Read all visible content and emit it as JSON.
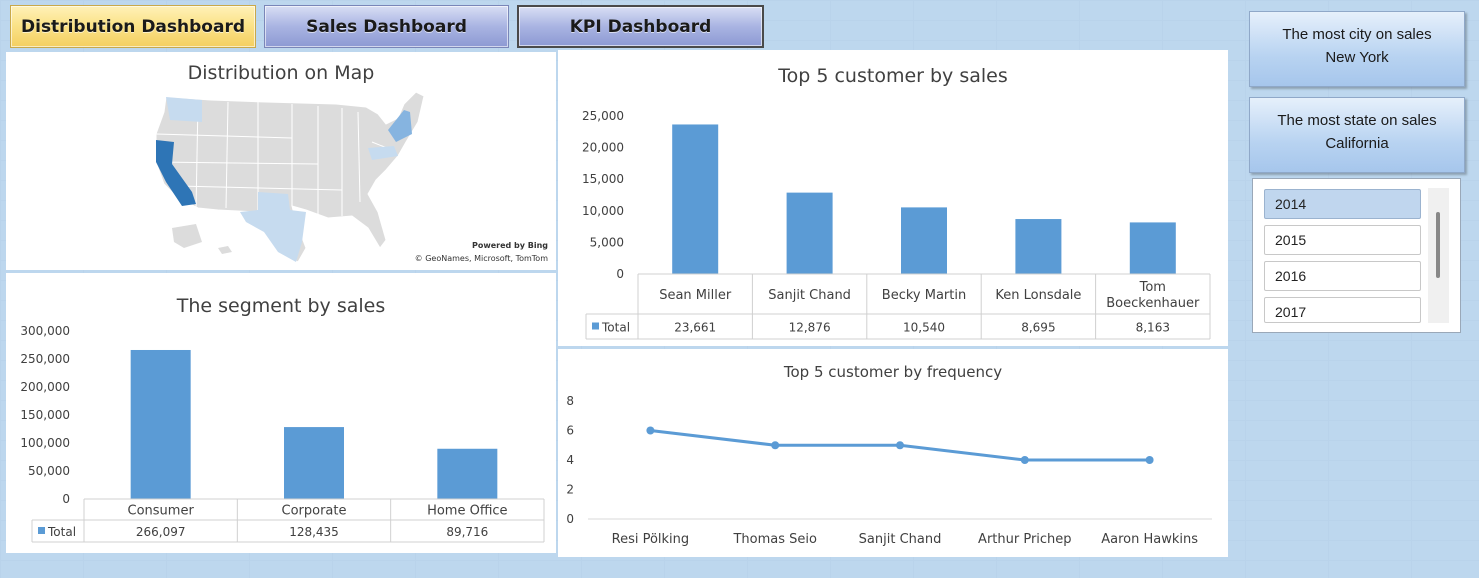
{
  "nav": {
    "distribution": "Distribution Dashboard",
    "sales": "Sales Dashboard",
    "kpi": "KPI Dashboard"
  },
  "map": {
    "title": "Distribution on Map",
    "attribution_line1": "Powered by Bing",
    "attribution_line2": "© GeoNames, Microsoft, TomTom",
    "colors": {
      "base": "#dcdcdc",
      "light": "#c6dbef",
      "medium": "#86b4e0",
      "dark": "#2e75b6"
    }
  },
  "kpis": {
    "city_label": "The most city on sales",
    "city_value": "New York",
    "state_label": "The most state on sales",
    "state_value": "California"
  },
  "slicer": {
    "items": [
      "2014",
      "2015",
      "2016",
      "2017"
    ],
    "selected": "2014"
  },
  "chart_data": [
    {
      "type": "bar",
      "title": "The segment by sales",
      "categories": [
        "Consumer",
        "Corporate",
        "Home Office"
      ],
      "series": [
        {
          "name": "Total",
          "values": [
            266097,
            128435,
            89716
          ]
        }
      ],
      "value_labels": [
        "266,097",
        "128,435",
        "89,716"
      ],
      "yticks": [
        "0",
        "50,000",
        "100,000",
        "150,000",
        "200,000",
        "250,000",
        "300,000"
      ],
      "ylim": [
        0,
        300000
      ],
      "legend": "data-table",
      "color": "#5b9bd5"
    },
    {
      "type": "bar",
      "title": "Top 5 customer by sales",
      "categories": [
        "Sean Miller",
        "Sanjit Chand",
        "Becky Martin",
        "Ken Lonsdale",
        "Tom Boeckenhauer"
      ],
      "series": [
        {
          "name": "Total",
          "values": [
            23661,
            12876,
            10540,
            8695,
            8163
          ]
        }
      ],
      "value_labels": [
        "23,661",
        "12,876",
        "10,540",
        "8,695",
        "8,163"
      ],
      "yticks": [
        "0",
        "5,000",
        "10,000",
        "15,000",
        "20,000",
        "25,000"
      ],
      "ylim": [
        0,
        25000
      ],
      "legend": "data-table",
      "color": "#5b9bd5"
    },
    {
      "type": "line",
      "title": "Top 5 customer by frequency",
      "categories": [
        "Resi Pölking",
        "Thomas Seio",
        "Sanjit Chand",
        "Arthur Prichep",
        "Aaron Hawkins"
      ],
      "values": [
        6,
        5,
        5,
        4,
        4
      ],
      "yticks": [
        "0",
        "2",
        "4",
        "6",
        "8"
      ],
      "ylim": [
        0,
        8
      ],
      "color": "#5b9bd5"
    }
  ]
}
